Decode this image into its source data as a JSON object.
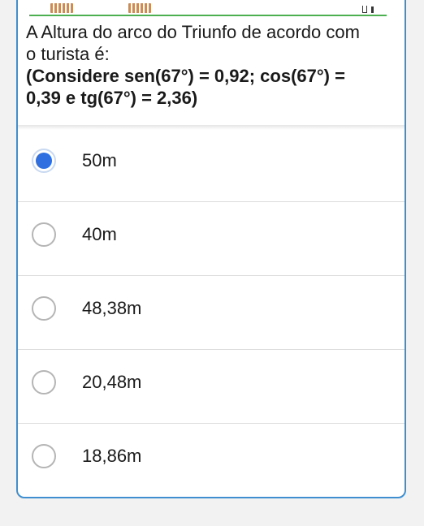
{
  "question": {
    "line1": "A Altura do arco do Triunfo de acordo com",
    "line2": "o turista é:",
    "line3": "(Considere sen(67°) = 0,92; cos(67°) =",
    "line4": "0,39 e tg(67°) = 2,36)"
  },
  "options": [
    {
      "label": "50m",
      "selected": true
    },
    {
      "label": "40m",
      "selected": false
    },
    {
      "label": "48,38m",
      "selected": false
    },
    {
      "label": "20,48m",
      "selected": false
    },
    {
      "label": "18,86m",
      "selected": false
    }
  ],
  "colors": {
    "accent": "#2f6fe0",
    "card_border": "#3f8fd0",
    "ground": "#4caf50",
    "pillar": "#c98b57"
  },
  "icons": {
    "radio_selected": "radio-selected-icon",
    "radio_unselected": "radio-unselected-icon"
  }
}
